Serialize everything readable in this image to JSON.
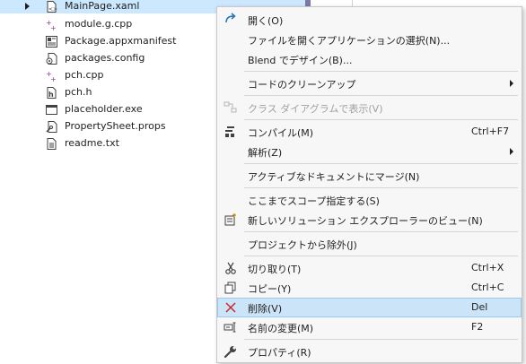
{
  "tree": {
    "files": [
      {
        "name": "MainPage.xaml",
        "icon": "xaml-file-icon",
        "selected": true,
        "expandable": true
      },
      {
        "name": "module.g.cpp",
        "icon": "cpp-file-icon"
      },
      {
        "name": "Package.appxmanifest",
        "icon": "manifest-file-icon"
      },
      {
        "name": "packages.config",
        "icon": "config-file-icon"
      },
      {
        "name": "pch.cpp",
        "icon": "cpp-file-icon"
      },
      {
        "name": "pch.h",
        "icon": "header-file-icon"
      },
      {
        "name": "placeholder.exe",
        "icon": "exe-file-icon"
      },
      {
        "name": "PropertySheet.props",
        "icon": "props-file-icon"
      },
      {
        "name": "readme.txt",
        "icon": "text-file-icon"
      }
    ]
  },
  "menu": {
    "items": [
      {
        "label": "開く(O)",
        "icon": "open-arrow-icon"
      },
      {
        "label": "ファイルを開くアプリケーションの選択(N)..."
      },
      {
        "label": "Blend でデザイン(B)..."
      },
      {
        "label": "コードのクリーンアップ",
        "submenu": true
      },
      {
        "label": "クラス ダイアグラムで表示(V)",
        "icon": "class-diagram-icon",
        "disabled": true
      },
      {
        "label": "コンパイル(M)",
        "shortcut": "Ctrl+F7",
        "icon": "compile-icon"
      },
      {
        "label": "解析(Z)",
        "submenu": true
      },
      {
        "label": "アクティブなドキュメントにマージ(N)"
      },
      {
        "label": "ここまでスコープ指定する(S)"
      },
      {
        "label": "新しいソリューション エクスプローラーのビュー(N)",
        "icon": "new-view-icon"
      },
      {
        "label": "プロジェクトから除外(J)"
      },
      {
        "label": "切り取り(T)",
        "shortcut": "Ctrl+X",
        "icon": "scissors-icon"
      },
      {
        "label": "コピー(Y)",
        "shortcut": "Ctrl+C",
        "icon": "copy-icon"
      },
      {
        "label": "削除(V)",
        "shortcut": "Del",
        "icon": "delete-x-icon",
        "highlighted": true
      },
      {
        "label": "名前の変更(M)",
        "shortcut": "F2",
        "icon": "rename-icon"
      },
      {
        "label": "プロパティ(R)",
        "icon": "wrench-icon"
      }
    ]
  },
  "colors": {
    "selection": "#cce8ff",
    "menu_background": "#f7f7f7",
    "menu_highlight": "#cce4f7",
    "delete_icon": "#c8262f",
    "open_icon": "#1e6fb4",
    "cpp_plus": "#8b3a8b"
  }
}
